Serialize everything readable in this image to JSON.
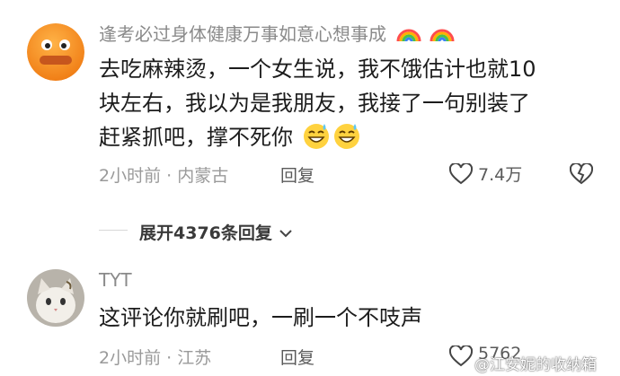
{
  "comments": [
    {
      "username": "逢考必过身体健康万事如意心想事成",
      "text_lines": [
        "去吃麻辣烫，一个女生说，我不饿估计也就10",
        "块左右，我以为是我朋友，我接了一句别装了",
        "赶紧抓吧，撑不死你"
      ],
      "time_location": "2小时前 · 内蒙古",
      "reply_label": "回复",
      "like_count": "7.4万"
    },
    {
      "username": "TYT",
      "text_lines": [
        "这评论你就刷吧，一刷一个不吱声"
      ],
      "time_location": "2小时前 · 江苏",
      "reply_label": "回复",
      "like_count": "5762"
    }
  ],
  "expand_replies": {
    "label": "展开4376条回复"
  },
  "watermark": "@江安妮的收纳箱",
  "colors": {
    "accent_username": "#8a8a8a",
    "text": "#1c1c1c",
    "meta": "#9a9a9a"
  }
}
